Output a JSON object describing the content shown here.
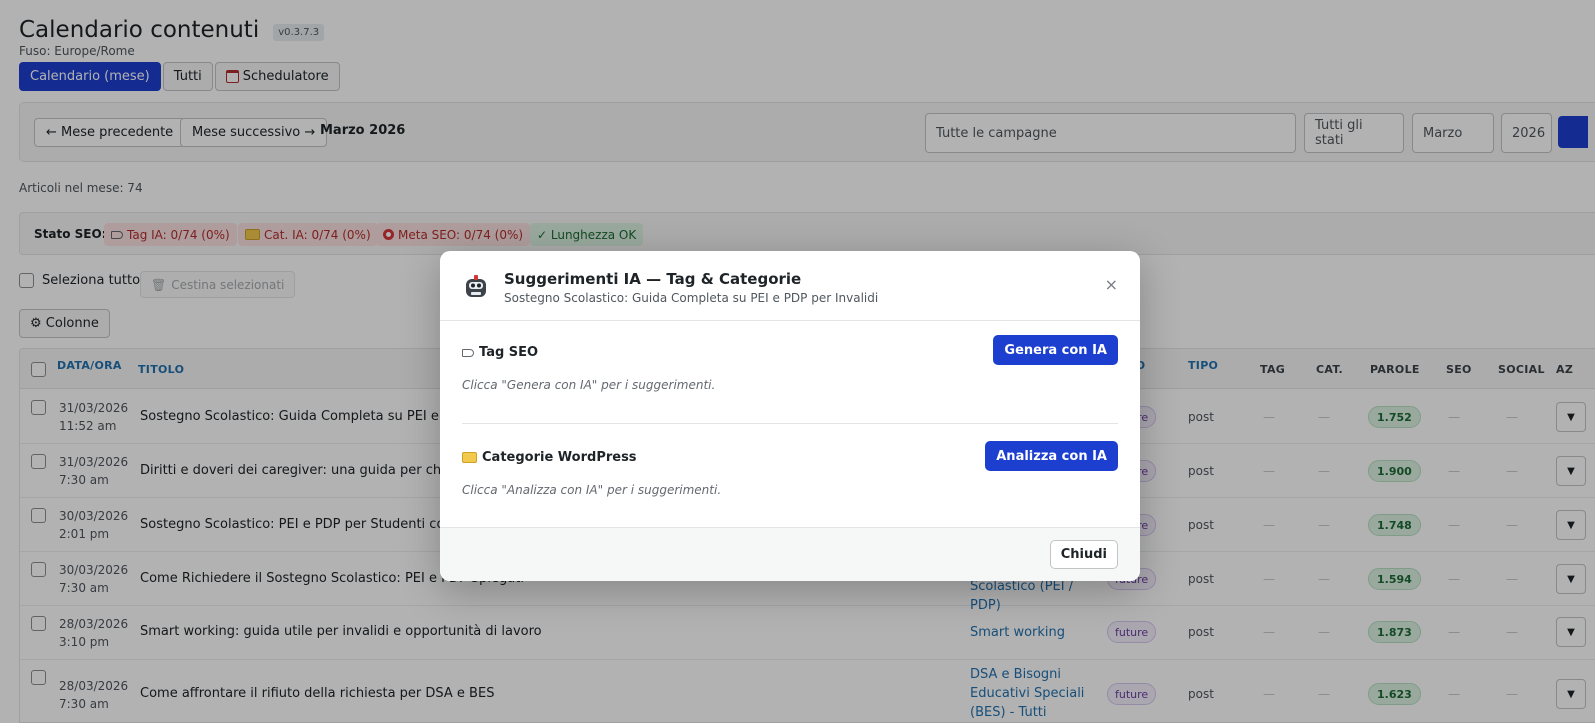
{
  "page": {
    "title": "Calendario contenuti",
    "version": "v0.3.7.3",
    "timezone": "Fuso: Europe/Rome"
  },
  "tabs": [
    {
      "label": "Calendario (mese)",
      "active": true
    },
    {
      "label": "Tutti",
      "active": false
    },
    {
      "label": "Schedulatore",
      "active": false
    }
  ],
  "toolbar": {
    "prev_label": "← Mese precedente",
    "next_label": "Mese successivo →",
    "current_month": "Marzo 2026",
    "campaign_select": "Tutte le campagne",
    "status_select": "Tutti gli stati",
    "month_select": "Marzo",
    "year_select": "2026"
  },
  "article_count": "Articoli nel mese: 74",
  "seo_status": {
    "label": "Stato SEO:",
    "tag_ia": "Tag IA: 0/74 (0%)",
    "cat_ia": "Cat. IA: 0/74 (0%)",
    "meta_seo": "Meta SEO: 0/74 (0%)",
    "length_ok": "✓ Lunghezza OK"
  },
  "selection": {
    "select_all": "Seleziona tutto",
    "trash_selected": "Cestina selezionati",
    "columns": "⚙ Colonne"
  },
  "table": {
    "headers": {
      "date": "DATA/ORA",
      "title": "TITOLO",
      "status": "ATO",
      "type": "TIPO",
      "tag": "TAG",
      "cat": "CAT.",
      "words": "PAROLE",
      "seo": "SEO",
      "social": "SOCIAL",
      "actions": "AZ"
    },
    "rows": [
      {
        "date": "31/03/2026",
        "time": "11:52 am",
        "title": "Sostegno Scolastico: Guida Completa su PEI e PDP",
        "category": "",
        "status": "future",
        "type": "post",
        "tag": "—",
        "cat": "—",
        "words": "1.752",
        "seo": "—",
        "social": "—"
      },
      {
        "date": "31/03/2026",
        "time": "7:30 am",
        "title": "Diritti e doveri dei caregiver: una guida per chi assi",
        "category": "",
        "status": "future",
        "type": "post",
        "tag": "—",
        "cat": "—",
        "words": "1.900",
        "seo": "—",
        "social": "—"
      },
      {
        "date": "30/03/2026",
        "time": "2:01 pm",
        "title": "Sostegno Scolastico: PEI e PDP per Studenti con Bis",
        "category": "",
        "status": "future",
        "type": "post",
        "tag": "—",
        "cat": "—",
        "words": "1.748",
        "seo": "—",
        "social": "—"
      },
      {
        "date": "30/03/2026",
        "time": "7:30 am",
        "title": "Come Richiedere il Sostegno Scolastico: PEI e PDP Spiegati",
        "category": "Sostegno Scolastico (PEI / PDP)",
        "status": "future",
        "type": "post",
        "tag": "—",
        "cat": "—",
        "words": "1.594",
        "seo": "—",
        "social": "—"
      },
      {
        "date": "28/03/2026",
        "time": "3:10 pm",
        "title": "Smart working: guida utile per invalidi e opportunità di lavoro",
        "category": "Smart working",
        "status": "future",
        "type": "post",
        "tag": "—",
        "cat": "—",
        "words": "1.873",
        "seo": "—",
        "social": "—"
      },
      {
        "date": "28/03/2026",
        "time": "7:30 am",
        "title": "Come affrontare il rifiuto della richiesta per DSA e BES",
        "category": "DSA e Bisogni Educativi Speciali (BES) - Tutti Recent",
        "status": "future",
        "type": "post",
        "tag": "—",
        "cat": "—",
        "words": "1.623",
        "seo": "—",
        "social": "—"
      }
    ]
  },
  "modal": {
    "icon": "robot-icon",
    "title": "Suggerimenti IA — Tag & Categorie",
    "subtitle": "Sostegno Scolastico: Guida Completa su PEI e PDP per Invalidi",
    "close": "×",
    "tag_section_title": "Tag SEO",
    "tag_button": "Genera con IA",
    "tag_hint": "Clicca \"Genera con IA\" per i suggerimenti.",
    "cat_section_title": "Categorie WordPress",
    "cat_button": "Analizza con IA",
    "cat_hint": "Clicca \"Analizza con IA\" per i suggerimenti.",
    "footer_close": "Chiudi"
  },
  "colors": {
    "primary": "#1d3fd0",
    "link": "#2271b1",
    "danger_bg": "#fbe1e1",
    "success_bg": "#dcf3e3"
  }
}
